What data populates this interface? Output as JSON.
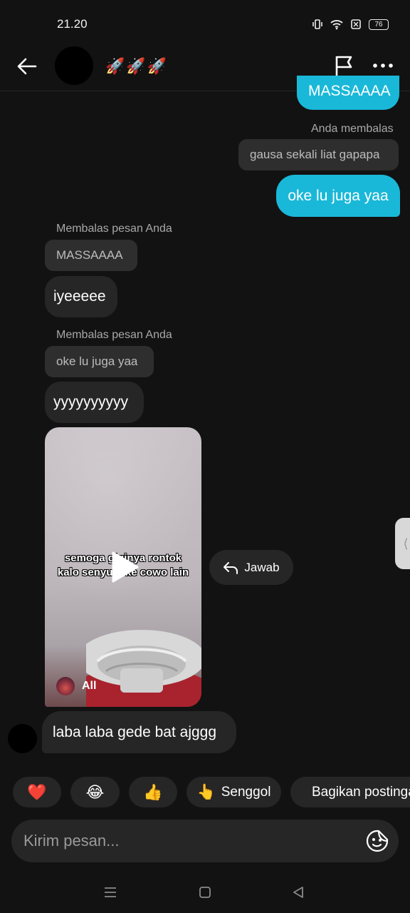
{
  "status_bar": {
    "time": "21.20",
    "battery": "76"
  },
  "header": {
    "contact_name": "🚀🚀🚀"
  },
  "messages": {
    "sent_1_partial": "MASSAAAA",
    "sent_reply_label": "Anda membalas",
    "sent_reply_quote": "gausa sekali liat gapapa",
    "sent_2": "oke lu juga yaa",
    "recv_reply_label_1": "Membalas pesan Anda",
    "recv_quote_1": "MASSAAAA",
    "recv_1": "iyeeeee",
    "recv_reply_label_2": "Membalas pesan Anda",
    "recv_quote_2": "oke lu juga yaa",
    "recv_2": "yyyyyyyyyy",
    "video_caption_line1": "semoga giginya rontok",
    "video_caption_line2": "kalo senyum ke cowo lain",
    "video_source": "All",
    "reply_button": "Jawab",
    "recv_3": "laba laba gede bat ajggg"
  },
  "quick_reactions": {
    "heart": "❤️",
    "laugh": "😂",
    "thumbs": "👍",
    "senggol": "Senggol",
    "senggol_emoji": "👆",
    "share": "Bagikan postingan"
  },
  "composer": {
    "placeholder": "Kirim pesan..."
  }
}
